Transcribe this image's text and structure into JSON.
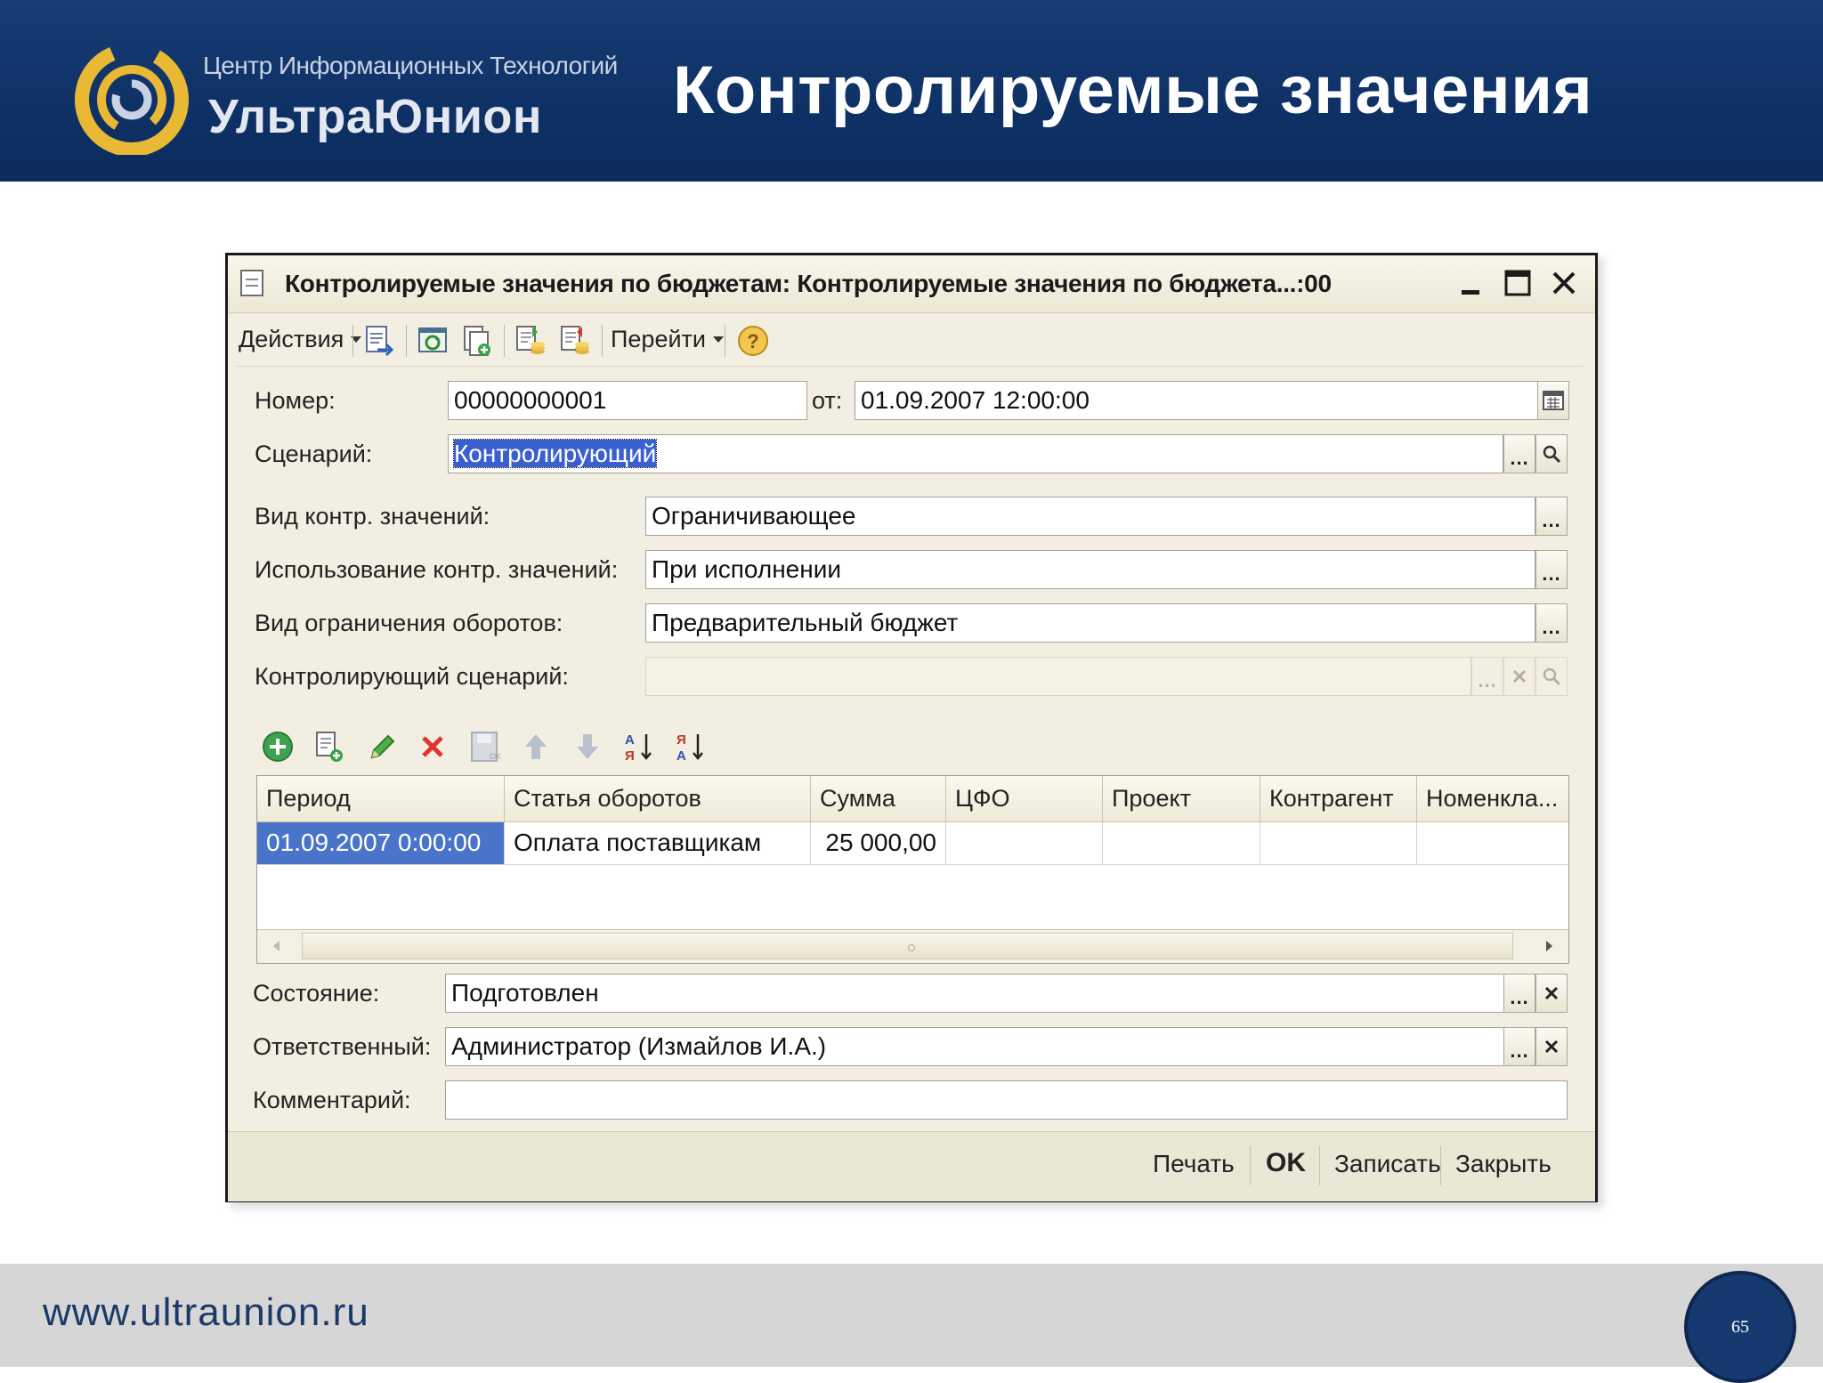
{
  "slide": {
    "company_line1": "Центр Информационных Технологий",
    "company_line2": "УльтраЮнион",
    "title": "Контролируемые значения",
    "footer_url": "www.ultraunion.ru",
    "page_number": "65"
  },
  "window": {
    "title": "Контролируемые значения по бюджетам: Контролируемые значения по бюджета...:00",
    "toolbar": {
      "actions_label": "Действия",
      "goto_label": "Перейти"
    },
    "fields": {
      "number_label": "Номер:",
      "number_value": "00000000001",
      "date_label": "от:",
      "date_value": "01.09.2007 12:00:00",
      "scenario_label": "Сценарий:",
      "scenario_value": "Контролирующий",
      "control_type_label": "Вид контр. значений:",
      "control_type_value": "Ограничивающее",
      "usage_label": "Использование контр. значений:",
      "usage_value": "При исполнении",
      "turnover_limit_label": "Вид ограничения оборотов:",
      "turnover_limit_value": "Предварительный бюджет",
      "controlling_scenario_label": "Контролирующий сценарий:",
      "controlling_scenario_value": ""
    },
    "table": {
      "columns": [
        "Период",
        "Статья оборотов",
        "Сумма",
        "ЦФО",
        "Проект",
        "Контрагент",
        "Номенкла..."
      ],
      "rows": [
        [
          "01.09.2007 0:00:00",
          "Оплата поставщикам",
          "25 000,00",
          "",
          "",
          "",
          ""
        ]
      ]
    },
    "footer_fields": {
      "status_label": "Состояние:",
      "status_value": "Подготовлен",
      "responsible_label": "Ответственный:",
      "responsible_value": "Администратор (Измайлов И.А.)",
      "comment_label": "Комментарий:",
      "comment_value": ""
    },
    "buttons": {
      "print": "Печать",
      "ok": "OK",
      "save": "Записать",
      "close": "Закрыть"
    }
  },
  "colors": {
    "header_bg": "#0f3267",
    "selection_blue": "#4a74c9",
    "window_bg": "#f2efe2",
    "logo_gold": "#e9b936"
  }
}
